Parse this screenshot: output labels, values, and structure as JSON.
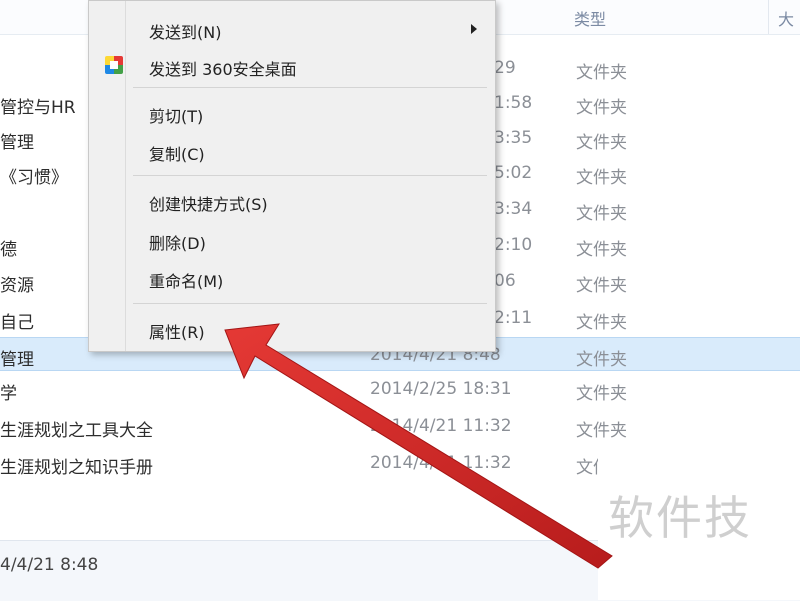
{
  "columns": {
    "type": "类型",
    "size": "大"
  },
  "rows": [
    {
      "name": "",
      "date": "29",
      "type": "文件夹"
    },
    {
      "name": "管控与HR",
      "date": "1:58",
      "type": "文件夹"
    },
    {
      "name": "管理",
      "date": "3:35",
      "type": "文件夹"
    },
    {
      "name": "《习惯》",
      "date": "5:02",
      "type": "文件夹"
    },
    {
      "name": "",
      "date": "3:34",
      "type": "文件夹"
    },
    {
      "name": "德",
      "date": "2:10",
      "type": "文件夹"
    },
    {
      "name": "资源",
      "date": "06",
      "type": "文件夹"
    },
    {
      "name": "自己",
      "date": "2:11",
      "type": "文件夹"
    },
    {
      "name": "管理",
      "date": "2014/4/21 8:48",
      "type": "文件夹"
    },
    {
      "name": "学",
      "date": "2014/2/25 18:31",
      "type": "文件夹"
    },
    {
      "name": "生涯规划之工具大全",
      "date": "2014/4/21 11:32",
      "type": "文件夹"
    },
    {
      "name": "生涯规划之知识手册",
      "date": "2014/4/21 11:32",
      "type": "文件夹"
    }
  ],
  "context_menu": {
    "send_to": "发送到(N)",
    "send_to_360": "发送到 360安全桌面",
    "cut": "剪切(T)",
    "copy": "复制(C)",
    "create_shortcut": "创建快捷方式(S)",
    "delete": "删除(D)",
    "rename": "重命名(M)",
    "properties": "属性(R)"
  },
  "status_bar": {
    "text": "4/4/21 8:48"
  },
  "watermark": {
    "text": "软件技"
  },
  "colors": {
    "selection": "#d9ebfb",
    "arrow": "#d32f2f",
    "menu_bg": "#f0f0f0"
  },
  "icons": [
    "submenu-arrow-icon",
    "360-desktop-icon"
  ]
}
